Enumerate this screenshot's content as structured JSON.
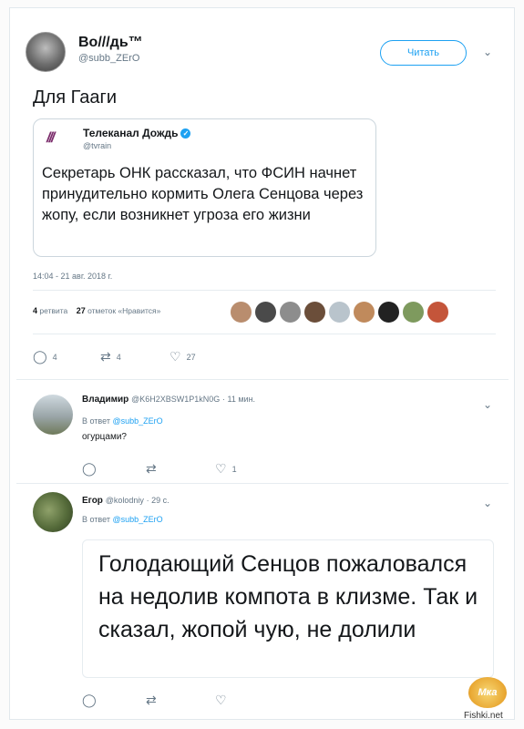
{
  "main_tweet": {
    "author_name": "Во///дь™",
    "author_handle": "@subb_ZErO",
    "follow_label": "Читать",
    "text": "Для Гааги",
    "timestamp": "14:04 - 21 авг. 2018 г.",
    "retweets_count": "4",
    "retweets_label": "ретвита",
    "likes_count": "27",
    "likes_label": "отметок «Нравится»",
    "actions": {
      "reply": "4",
      "retweet": "4",
      "like": "27"
    }
  },
  "quoted_tweet": {
    "logo_text": "///",
    "name": "Телеканал Дождь",
    "handle": "@tvrain",
    "text": "Секретарь ОНК рассказал, что ФСИН начнет принудительно кормить Олега Сенцова через жопу, если возникнет угроза его жизни"
  },
  "replies": [
    {
      "name": "Владимир",
      "handle": "@K6H2XBSW1P1kN0G",
      "time": "· 11 мин.",
      "reply_prefix": "В ответ",
      "reply_to": "@subb_ZErO",
      "text": "огурцами?",
      "actions": {
        "reply": "",
        "retweet": "",
        "like": "1"
      }
    },
    {
      "name": "Егор",
      "handle": "@kolodniy",
      "time": "· 29 с.",
      "reply_prefix": "В ответ",
      "reply_to": "@subb_ZErO",
      "text": "Голодающий Сенцов пожаловался на недолив компота в клизме. Так и сказал, жопой чую, не долили",
      "actions": {
        "reply": "",
        "retweet": "",
        "like": ""
      }
    }
  ],
  "watermark": {
    "logo_text": "Мка",
    "site": "Fishki.net"
  },
  "colors": {
    "accent": "#1da1f2",
    "muted": "#657786",
    "border": "#e6ecf0"
  },
  "icons": {
    "reply": "reply-icon",
    "retweet": "retweet-icon",
    "like": "heart-icon",
    "more": "chevron-down-icon",
    "verified": "verified-badge-icon"
  }
}
